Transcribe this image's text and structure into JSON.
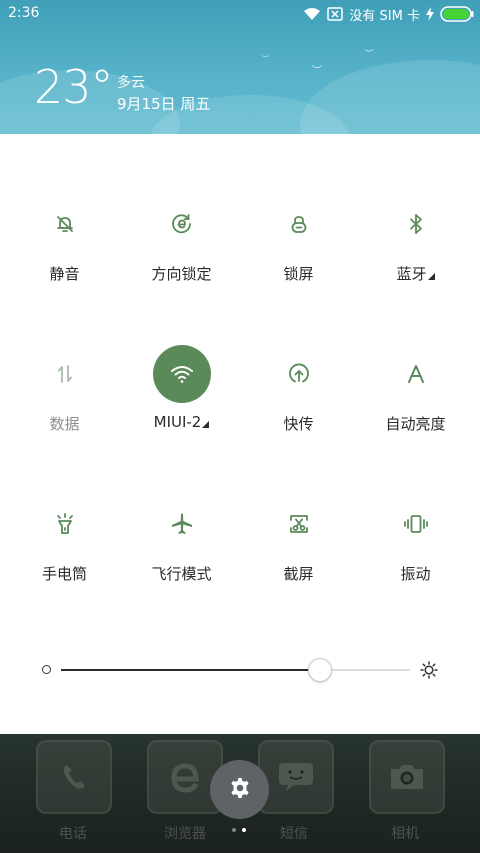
{
  "status_bar": {
    "time": "2:36",
    "carrier": "没有 SIM 卡"
  },
  "weather": {
    "temperature": "23°",
    "condition": "多云",
    "date": "9月15日 周五"
  },
  "toggles": [
    {
      "label": "静音",
      "icon": "bell-off-icon",
      "active": false,
      "enabled": true
    },
    {
      "label": "方向锁定",
      "icon": "rotation-lock-icon",
      "active": false,
      "enabled": true
    },
    {
      "label": "锁屏",
      "icon": "lock-icon",
      "active": false,
      "enabled": true
    },
    {
      "label": "蓝牙",
      "icon": "bluetooth-icon",
      "active": false,
      "enabled": true,
      "expandable": true
    },
    {
      "label": "数据",
      "icon": "mobile-data-icon",
      "active": false,
      "enabled": false
    },
    {
      "label": "MIUI-2",
      "icon": "wifi-icon",
      "active": true,
      "enabled": true,
      "expandable": true
    },
    {
      "label": "快传",
      "icon": "quick-transfer-icon",
      "active": false,
      "enabled": true
    },
    {
      "label": "自动亮度",
      "icon": "auto-brightness-icon",
      "active": false,
      "enabled": true
    },
    {
      "label": "手电筒",
      "icon": "flashlight-icon",
      "active": false,
      "enabled": true
    },
    {
      "label": "飞行模式",
      "icon": "airplane-icon",
      "active": false,
      "enabled": true
    },
    {
      "label": "截屏",
      "icon": "screenshot-icon",
      "active": false,
      "enabled": true
    },
    {
      "label": "振动",
      "icon": "vibrate-icon",
      "active": false,
      "enabled": true
    }
  ],
  "brightness": {
    "level": 0.74
  },
  "dock": {
    "apps": [
      "电话",
      "浏览器",
      "短信",
      "相机"
    ],
    "page_count": 2,
    "current_page": 1
  },
  "colors": {
    "accent": "#5b8a5a",
    "header": "#56b2c9",
    "text": "#2b2b2b",
    "disabled": "#8e8e8e"
  }
}
